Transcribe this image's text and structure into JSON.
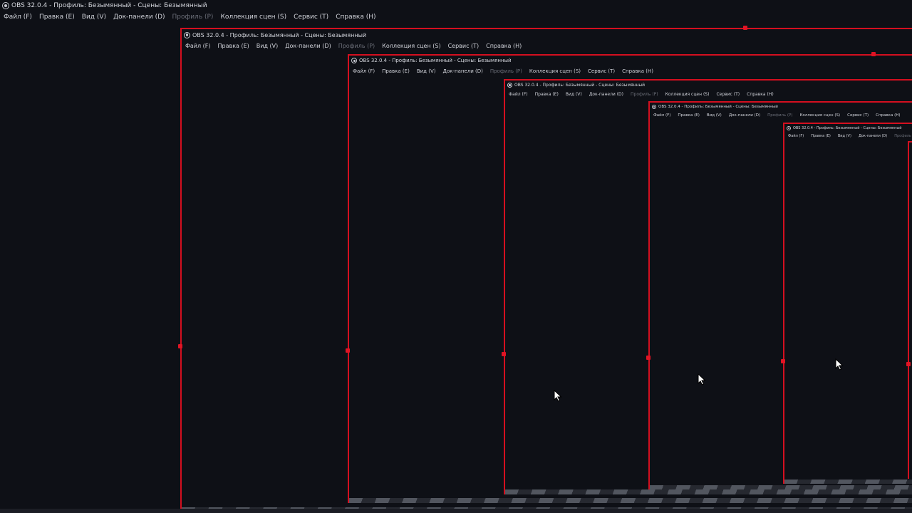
{
  "window": {
    "title": "OBS 32.0.4 - Профиль: Безымянный - Сцены: Безымянный",
    "menu": [
      {
        "label": "Файл (F)",
        "enabled": true
      },
      {
        "label": "Правка (E)",
        "enabled": true
      },
      {
        "label": "Вид (V)",
        "enabled": true
      },
      {
        "label": "Док-панели (D)",
        "enabled": true
      },
      {
        "label": "Профиль (P)",
        "enabled": false
      },
      {
        "label": "Коллекция сцен (S)",
        "enabled": true
      },
      {
        "label": "Сервис (T)",
        "enabled": true
      },
      {
        "label": "Справка (H)",
        "enabled": true
      }
    ]
  },
  "colors": {
    "background": "#0e1016",
    "selection_border": "#d40f1f",
    "menu_text": "#d0d2d9",
    "menu_disabled": "#6b6e78"
  },
  "icons": {
    "app": "obs-logo-icon",
    "pointer": "mouse-pointer-icon"
  }
}
